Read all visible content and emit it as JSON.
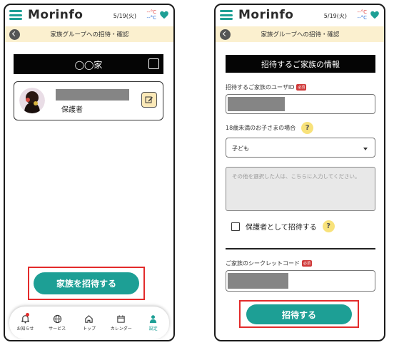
{
  "screens": {
    "left": {
      "header": {
        "brand": "Morinfo",
        "date": "5/19(火)",
        "temp_high": "--°C",
        "temp_low": "--°C",
        "icons": [
          "menu-icon",
          "heart-icon"
        ]
      },
      "subheader": {
        "title": "家族グループへの招待・確認"
      },
      "family_name": "◯◯家",
      "member": {
        "role": "保護者"
      },
      "invite_button": "家族を招待する",
      "bottom_nav": [
        {
          "label": "お知らせ",
          "icon": "bell-icon",
          "badge": true
        },
        {
          "label": "サービス",
          "icon": "globe-icon"
        },
        {
          "label": "トップ",
          "icon": "home-icon"
        },
        {
          "label": "カレンダー",
          "icon": "calendar-icon"
        },
        {
          "label": "設定",
          "icon": "person-icon",
          "active": true
        }
      ]
    },
    "right": {
      "header": {
        "brand": "Morinfo",
        "date": "5/19(火)",
        "temp_high": "--°C",
        "temp_low": "--°C"
      },
      "subheader": {
        "title": "家族グループへの招待・確認"
      },
      "section_title": "招待するご家族の情報",
      "user_id_label": "招待するご家族のユーザID",
      "required_badge": "必須",
      "child_label": "18歳未満のお子さまの場合",
      "help_mark": "?",
      "relation_select_value": "子ども",
      "other_placeholder": "その他を選択した人は、こちらに入力してください。",
      "guardian_checkbox_label": "保護者として招待する",
      "secret_code_label": "ご家族のシークレットコード",
      "submit_button": "招待する"
    }
  },
  "colors": {
    "accent": "#1d9f95",
    "highlight": "#e32b2b",
    "subbar_bg": "#fbf0cf",
    "help_bg": "#f8e27b"
  }
}
